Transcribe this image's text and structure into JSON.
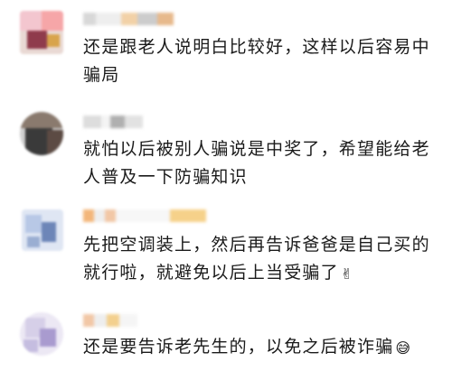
{
  "comments": [
    {
      "lines": [
        "还是跟老人说明白比较好，这样以后容易中",
        "骗局"
      ],
      "emoji": "",
      "colors": {
        "avatar": [
          "#f3c6cf",
          "#8f3b4c",
          "#f6a6a8",
          "#e9d9d4"
        ],
        "name": [
          "#d8d8d8",
          "#f2d1a7",
          "#cccccc",
          "#e7b98c"
        ]
      }
    },
    {
      "lines": [
        "就怕以后被别人骗说是中奖了，希望能给老",
        "人普及一下防骗知识"
      ],
      "emoji": "",
      "colors": {
        "avatar": [
          "#3a3a3a",
          "#8a7a6e",
          "#cfcfcf",
          "#5c4b44"
        ],
        "name": [
          "#dddddd",
          "#b0b0b0",
          "#eeeeee"
        ]
      }
    },
    {
      "lines": [
        "先把空调装上，然后再告诉爸爸是自己买的",
        "就行啦，就避免以后上当受骗了"
      ],
      "emoji": "✌",
      "colors": {
        "avatar": [
          "#b8c8e6",
          "#6d86b8",
          "#dfe6f3",
          "#9aaed2"
        ],
        "name": [
          "#f2c7a6",
          "#eeeeee",
          "#f6d18a",
          "#f3b67a"
        ]
      }
    },
    {
      "lines": [
        "还是要告诉老先生的，以免之后被诈骗"
      ],
      "emoji": "😅",
      "colors": {
        "avatar": [
          "#d6cfe8",
          "#a99bcf",
          "#ece8f4",
          "#c5bde0"
        ],
        "name": [
          "#f2c7a6",
          "#eeeeee",
          "#f3d08e"
        ]
      }
    }
  ]
}
